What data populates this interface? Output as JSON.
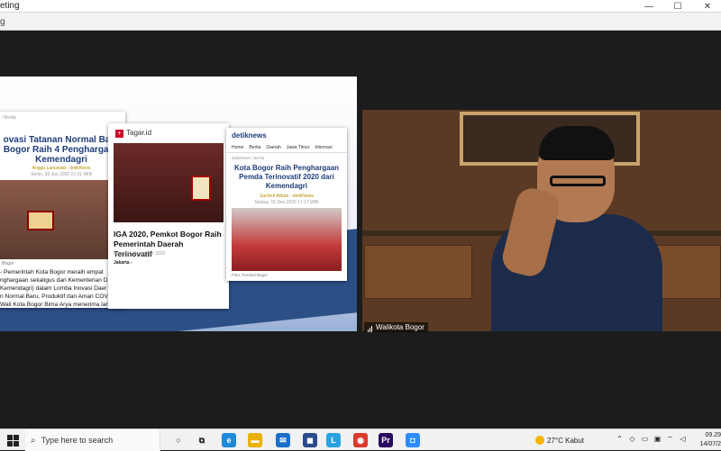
{
  "window": {
    "title": "eting",
    "subtitle": "g",
    "minimize": "—",
    "maximize": "☐",
    "close": "✕"
  },
  "share": {
    "card1": {
      "headline": "ovasi Tatanan Normal Baru\nBogor Raih 4 Penghargaan\nKemendagri",
      "byline": "Angga Laraswati - detikNews",
      "date": "Senin, 29 Jun 2020 21:01 WIB",
      "caption": "Bogor",
      "body": "- Pemerintah Kota Bogor meraih empat\nnghargaan sekaligus dari Kementerian Dalam\nKemendagri) dalam Lomba Inovasi Daer\nn Normal Baru, Produktif dan Aman COV\nWali Kota Bogor Bima Arya menerima langsun\npenghargaan dari empat kategori berbeda"
    },
    "card2": {
      "logo": "Tagar.id",
      "headline": "IGA 2020, Pemkot Bogor Raih\nPemerintah Daerah Terinovatif",
      "date": "Rabu, 16 Desember 2020",
      "body_prefix": "Jakarta -"
    },
    "card3": {
      "logo": "detiknews",
      "nav": [
        "Home",
        "Berita",
        "Daerah",
        "Jawa Timur",
        "Internasi"
      ],
      "breadcrumb": "detikNews / Berita",
      "headline": "Kota Bogor Raih Penghargaan\nPemda Terinovatif 2020 dari\nKemendagri",
      "byline": "Sachrul Akbari - detikNews",
      "date": "Selasa, 15 Des 2020 17:17 WIB",
      "caption": "Foto: Pemkot Bogor"
    }
  },
  "video": {
    "participant_name": "Walikota Bogor"
  },
  "taskbar": {
    "search_placeholder": "Type here to search",
    "apps": [
      {
        "name": "cortana-icon",
        "glyph": "○",
        "color": "#222222"
      },
      {
        "name": "task-view-icon",
        "glyph": "⧉",
        "color": "#222222"
      },
      {
        "name": "edge-icon",
        "glyph": "e",
        "color": "#1f8ad8"
      },
      {
        "name": "file-explorer-icon",
        "glyph": "▬",
        "color": "#e8b000"
      },
      {
        "name": "mail-icon",
        "glyph": "✉",
        "color": "#1a6fc9"
      },
      {
        "name": "store-icon",
        "glyph": "◼",
        "color": "#2a4a8a"
      },
      {
        "name": "app-l-icon",
        "glyph": "L",
        "color": "#29a3e0"
      },
      {
        "name": "chrome-icon",
        "glyph": "◉",
        "color": "#d93a2b"
      },
      {
        "name": "premiere-icon",
        "glyph": "Pr",
        "color": "#2a0a5e"
      },
      {
        "name": "zoom-icon",
        "glyph": "◘",
        "color": "#2d8cff"
      }
    ],
    "weather": {
      "temp": "27°C",
      "condition": "Kabut"
    },
    "clock": {
      "time": "09.29",
      "date": "14/07/2"
    }
  }
}
